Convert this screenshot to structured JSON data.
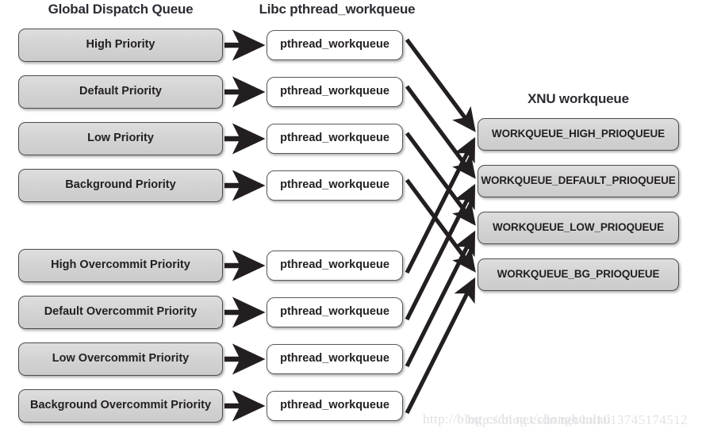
{
  "columns": {
    "global_dispatch": {
      "title": "Global Dispatch Queue",
      "items": [
        {
          "label": "High Priority"
        },
        {
          "label": "Default Priority"
        },
        {
          "label": "Low Priority"
        },
        {
          "label": "Background Priority"
        },
        {
          "label": "High Overcommit Priority"
        },
        {
          "label": "Default Overcommit Priority"
        },
        {
          "label": "Low Overcommit Priority"
        },
        {
          "label": "Background Overcommit Priority"
        }
      ]
    },
    "libc": {
      "title": "Libc pthread_workqueue",
      "items": [
        {
          "label": "pthread_workqueue"
        },
        {
          "label": "pthread_workqueue"
        },
        {
          "label": "pthread_workqueue"
        },
        {
          "label": "pthread_workqueue"
        },
        {
          "label": "pthread_workqueue"
        },
        {
          "label": "pthread_workqueue"
        },
        {
          "label": "pthread_workqueue"
        },
        {
          "label": "pthread_workqueue"
        }
      ]
    },
    "xnu": {
      "title": "XNU workqueue",
      "items": [
        {
          "label": "WORKQUEUE_HIGH_PRIOQUEUE"
        },
        {
          "label": "WORKQUEUE_DEFAULT_PRIOQUEUE"
        },
        {
          "label": "WORKQUEUE_LOW_PRIOQUEUE"
        },
        {
          "label": "WORKQUEUE_BG_PRIOQUEUE"
        }
      ]
    }
  },
  "watermark": {
    "line_a": "http://blog.csdn.net/chonghuohui",
    "line_b": "http://blog.csdn.net/hu1013745174512"
  },
  "colors": {
    "box_gray_fill": "#d4d4d5",
    "box_white_fill": "#ffffff",
    "box_border": "#4d4d4d",
    "arrow": "#231f20",
    "text": "#231f20",
    "title_text": "#2b2b33",
    "watermark": "#dfdfe2",
    "background": "#ffffff"
  }
}
